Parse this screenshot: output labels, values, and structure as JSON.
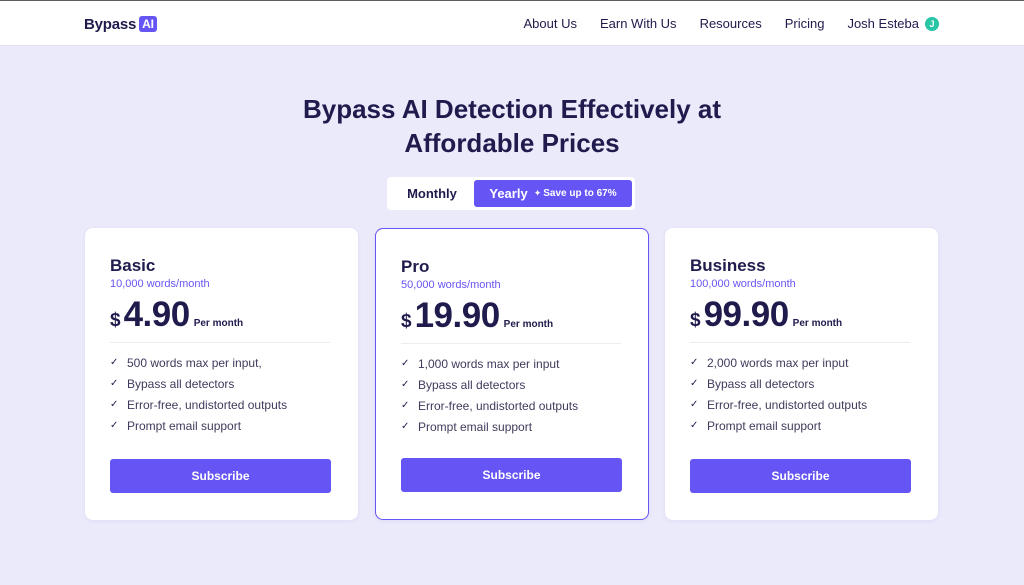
{
  "nav": {
    "logo_text": "Bypass",
    "logo_badge": "AI",
    "links": [
      "About Us",
      "Earn With Us",
      "Resources",
      "Pricing"
    ],
    "user_name": "Josh Esteba",
    "user_initial": "J"
  },
  "hero": {
    "title_line1": "Bypass AI Detection Effectively at",
    "title_line2": "Affordable Prices"
  },
  "billing_toggle": {
    "monthly_label": "Monthly",
    "yearly_label": "Yearly",
    "yearly_badge": "Save up to 67%",
    "selected": "Yearly"
  },
  "plans": [
    {
      "name": "Basic",
      "words": "10,000 words/month",
      "currency": "$",
      "price": "4.90",
      "period": "Per month",
      "features": [
        "500 words max per input,",
        "Bypass all detectors",
        "Error-free, undistorted outputs",
        "Prompt email support"
      ],
      "cta": "Subscribe"
    },
    {
      "name": "Pro",
      "words": "50,000 words/month",
      "currency": "$",
      "price": "19.90",
      "period": "Per month",
      "features": [
        "1,000 words max per input",
        "Bypass all detectors",
        "Error-free, undistorted outputs",
        "Prompt email support"
      ],
      "cta": "Subscribe"
    },
    {
      "name": "Business",
      "words": "100,000 words/month",
      "currency": "$",
      "price": "99.90",
      "period": "Per month",
      "features": [
        "2,000 words max per input",
        "Bypass all detectors",
        "Error-free, undistorted outputs",
        "Prompt email support"
      ],
      "cta": "Subscribe"
    }
  ],
  "colors": {
    "accent": "#6655f5",
    "background": "#ebeafb",
    "text": "#1f1b4d",
    "avatar": "#28c6a6"
  }
}
